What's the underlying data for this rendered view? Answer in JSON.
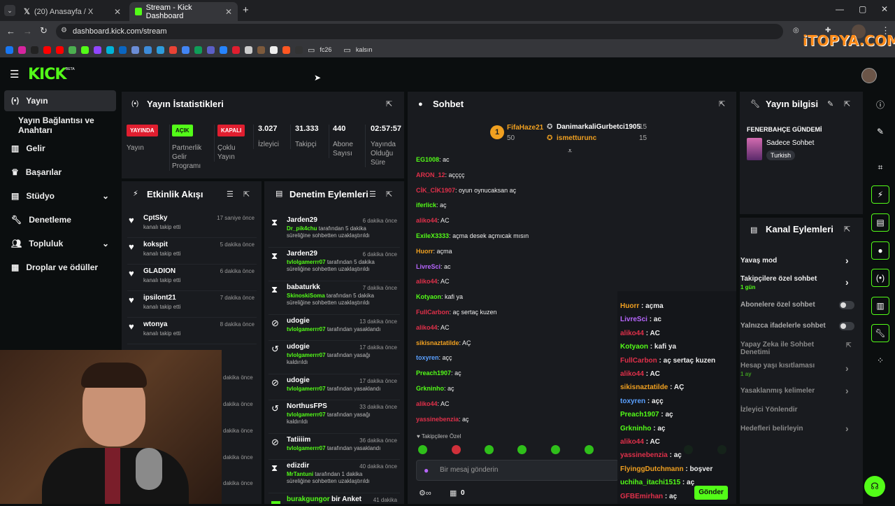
{
  "browser": {
    "tabs": [
      {
        "title": "(20) Anasayfa / X"
      },
      {
        "title": "Stream - Kick Dashboard"
      }
    ],
    "url": "dashboard.kick.com/stream",
    "bookmarks": [
      "fc26",
      "kalsın"
    ]
  },
  "header": {
    "logo": "KICK",
    "logo_beta": "BETA"
  },
  "sidebar": {
    "items": [
      {
        "label": "Yayın",
        "icon": "broadcast-icon"
      },
      {
        "label": "Yayın Bağlantısı ve Anahtarı"
      },
      {
        "label": "Gelir",
        "icon": "chart-icon"
      },
      {
        "label": "Başarılar",
        "icon": "trophy-icon"
      },
      {
        "label": "Stüdyo",
        "icon": "studio-icon"
      },
      {
        "label": "Denetleme",
        "icon": "wrench-icon"
      },
      {
        "label": "Topluluk",
        "icon": "people-icon"
      },
      {
        "label": "Droplar ve ödüller",
        "icon": "gift-icon"
      }
    ]
  },
  "stats": {
    "title": "Yayın İstatistikleri",
    "badges": [
      {
        "badge": "YAYINDA",
        "label": "Yayın",
        "color": "#e01e2f"
      },
      {
        "badge": "AÇIK",
        "label": "Partnerlik Gelir Programı",
        "color": "#53fc18"
      },
      {
        "badge": "KAPALI",
        "label": "Çoklu Yayın",
        "color": "#e01e2f"
      }
    ],
    "values": [
      {
        "value": "3.027",
        "label": "İzleyici"
      },
      {
        "value": "31.333",
        "label": "Takipçi"
      },
      {
        "value": "440",
        "label": "Abone Sayısı"
      },
      {
        "value": "02:57:57",
        "label": "Yayında Olduğu Süre"
      }
    ]
  },
  "activity": {
    "title": "Etkinlik Akışı",
    "items": [
      {
        "name": "CptSky",
        "sub": "kanalı takip etti",
        "time": "17 saniye önce"
      },
      {
        "name": "kokspit",
        "sub": "kanalı takip etti",
        "time": "5 dakika önce"
      },
      {
        "name": "GLADION",
        "sub": "kanalı takip etti",
        "time": "6 dakika önce"
      },
      {
        "name": "ipsilont21",
        "sub": "kanalı takip etti",
        "time": "7 dakika önce"
      },
      {
        "name": "wtonya",
        "sub": "kanalı takip etti",
        "time": "8 dakika önce"
      }
    ],
    "more_times": [
      "dakika önce",
      "dakika önce",
      "dakika önce",
      "dakika önce",
      "dakika önce"
    ]
  },
  "moderation": {
    "title": "Denetim Eylemleri",
    "items": [
      {
        "name": "Jarden29",
        "by": "Dr_pik4chu",
        "text": " tarafından 5 dakika süreliğine sohbetten uzaklaştırıldı",
        "time": "6 dakika önce",
        "icon": "hourglass-icon"
      },
      {
        "name": "Jarden29",
        "by": "tvlolgamerrr07",
        "text": " tarafından 5 dakika süreliğine sohbetten uzaklaştırıldı",
        "time": "6 dakika önce",
        "icon": "hourglass-icon"
      },
      {
        "name": "babaturkk",
        "by": "SkinoskiSoma",
        "text": " tarafından 5 dakika süreliğine sohbetten uzaklaştırıldı",
        "time": "7 dakika önce",
        "icon": "hourglass-icon"
      },
      {
        "name": "udogie",
        "by": "tvlolgamerrr07",
        "text": " tarafından yasaklandı",
        "time": "13 dakika önce",
        "icon": "ban-icon"
      },
      {
        "name": "udogie",
        "by": "tvlolgamerrr07",
        "text": " tarafından yasağı kaldırıldı",
        "time": "17 dakika önce",
        "icon": "undo-icon"
      },
      {
        "name": "udogie",
        "by": "tvlolgamerrr07",
        "text": " tarafından yasaklandı",
        "time": "17 dakika önce",
        "icon": "ban-icon"
      },
      {
        "name": "NorthusFPS",
        "by": "tvlolgamerrr07",
        "text": " tarafından yasağı kaldırıldı",
        "time": "33 dakika önce",
        "icon": "undo-icon"
      },
      {
        "name": "Tatiiiim",
        "by": "tvlolgamerrr07",
        "text": " tarafından yasaklandı",
        "time": "36 dakika önce",
        "icon": "ban-icon"
      },
      {
        "name": "edizdir",
        "by": "MrTantuni",
        "text": " tarafından 1 dakika süreliğine sohbetten uzaklaştırıldı",
        "time": "40 dakika önce",
        "icon": "hourglass-icon"
      },
      {
        "name": "burakgungor",
        "by": "",
        "text": " bir Anket",
        "time": "41 dakika",
        "icon": "poll-icon"
      }
    ]
  },
  "chat": {
    "title": "Sohbet",
    "pinned": [
      {
        "name": "FifaHaze21",
        "count": "50",
        "rank": "1"
      },
      {
        "name": "DanimarkaliGurbetci1905",
        "count": "15"
      },
      {
        "name": "ismetturunc",
        "count": "15"
      }
    ],
    "messages": [
      {
        "user": "EG1008",
        "text": "ac",
        "color": "#53fc18"
      },
      {
        "user": "ARON_12",
        "text": "açççç",
        "color": "#e0304a"
      },
      {
        "user": "CİK_CİK1907",
        "text": "oyun oynucaksan aç",
        "color": "#e0304a"
      },
      {
        "user": "iferlick",
        "text": "aç",
        "color": "#53fc18"
      },
      {
        "user": "aliko44",
        "text": "AC",
        "color": "#e0304a"
      },
      {
        "user": "ExileX3333",
        "text": "açma desek açmıcak mısın",
        "color": "#53fc18"
      },
      {
        "user": "Huorr",
        "text": "açma",
        "color": "#f0a020"
      },
      {
        "user": "LivreSci",
        "text": "ac",
        "color": "#b866ff"
      },
      {
        "user": "aliko44",
        "text": "AC",
        "color": "#e0304a"
      },
      {
        "user": "Kotyaon",
        "text": "kafi ya",
        "color": "#53fc18"
      },
      {
        "user": "FullCarbon",
        "text": "aç sertaç kuzen",
        "color": "#e0304a"
      },
      {
        "user": "aliko44",
        "text": "AC",
        "color": "#e0304a"
      },
      {
        "user": "sikisnaztatilde",
        "text": "AÇ",
        "color": "#f0a020"
      },
      {
        "user": "toxyren",
        "text": "açç",
        "color": "#5aa0ff"
      },
      {
        "user": "Preach1907",
        "text": "aç",
        "color": "#53fc18"
      },
      {
        "user": "Grkninho",
        "text": "aç",
        "color": "#53fc18"
      },
      {
        "user": "aliko44",
        "text": "AC",
        "color": "#e0304a"
      },
      {
        "user": "yassinebenzia",
        "text": "aç",
        "color": "#e0304a"
      }
    ],
    "followers_only": "Takipçilere Özel",
    "input_placeholder": "Bir mesaj gönderin",
    "count": "0"
  },
  "overlay_chat": {
    "messages": [
      {
        "user": "Huorr",
        "text": " : açma",
        "color": "#f0a020"
      },
      {
        "user": "LivreSci",
        "text": " : ac",
        "color": "#b866ff"
      },
      {
        "user": "aliko44",
        "text": " : AC",
        "color": "#e0304a"
      },
      {
        "user": "Kotyaon",
        "text": " : kafi ya",
        "color": "#53fc18"
      },
      {
        "user": "FullCarbon",
        "text": " : aç sertaç kuzen",
        "color": "#e0304a"
      },
      {
        "user": "aliko44",
        "text": " : AC",
        "color": "#e0304a"
      },
      {
        "user": "sikisnaztatilde",
        "text": " : AÇ",
        "color": "#f0a020"
      },
      {
        "user": "toxyren",
        "text": " : açç",
        "color": "#5aa0ff"
      },
      {
        "user": "Preach1907",
        "text": " : aç",
        "color": "#53fc18"
      },
      {
        "user": "Grkninho",
        "text": " : aç",
        "color": "#53fc18"
      },
      {
        "user": "aliko44",
        "text": " : AC",
        "color": "#e0304a"
      },
      {
        "user": "yassinebenzia",
        "text": " : aç",
        "color": "#e0304a"
      },
      {
        "user": "FlyinggDutchmann",
        "text": " : boşver",
        "color": "#f0a020"
      },
      {
        "user": "uchiha_itachi1515",
        "text": " : aç",
        "color": "#53fc18"
      },
      {
        "user": "GFBEmirhan",
        "text": " : aç",
        "color": "#e0304a"
      }
    ],
    "send_label": "Gönder"
  },
  "stream_info": {
    "title": "Yayın bilgisi",
    "stream_title": "FENERBAHÇE GÜNDEMİ",
    "category": "Sadece Sohbet",
    "language": "Turkish"
  },
  "channel_actions": {
    "title": "Kanal Eylemleri",
    "items": [
      {
        "label": "Yavaş mod",
        "sub": "",
        "control": "chevron"
      },
      {
        "label": "Takipçilere özel sohbet",
        "sub": "1 gün",
        "control": "chevron"
      },
      {
        "label": "Abonelere özel sohbet",
        "sub": "",
        "control": "toggle"
      },
      {
        "label": "Yalnızca ifadelerle sohbet",
        "sub": "",
        "control": "toggle"
      },
      {
        "label": "Yapay Zeka ile Sohbet Denetimi",
        "sub": "",
        "control": "external"
      },
      {
        "label": "Hesap yaşı kısıtlaması",
        "sub": "1 ay",
        "control": "chevron"
      },
      {
        "label": "Yasaklanmış kelimeler",
        "sub": "",
        "control": "chevron"
      },
      {
        "label": "İzleyici Yönlendir",
        "sub": "",
        "control": "none"
      },
      {
        "label": "Hedefleri belirleyin",
        "sub": "",
        "control": "chevron"
      }
    ]
  },
  "watermark": "iTOPYA.COM",
  "colors": {
    "accent": "#53fc18",
    "live": "#e01e2f",
    "panel": "#191b1f",
    "bg": "#0b0e0f"
  }
}
